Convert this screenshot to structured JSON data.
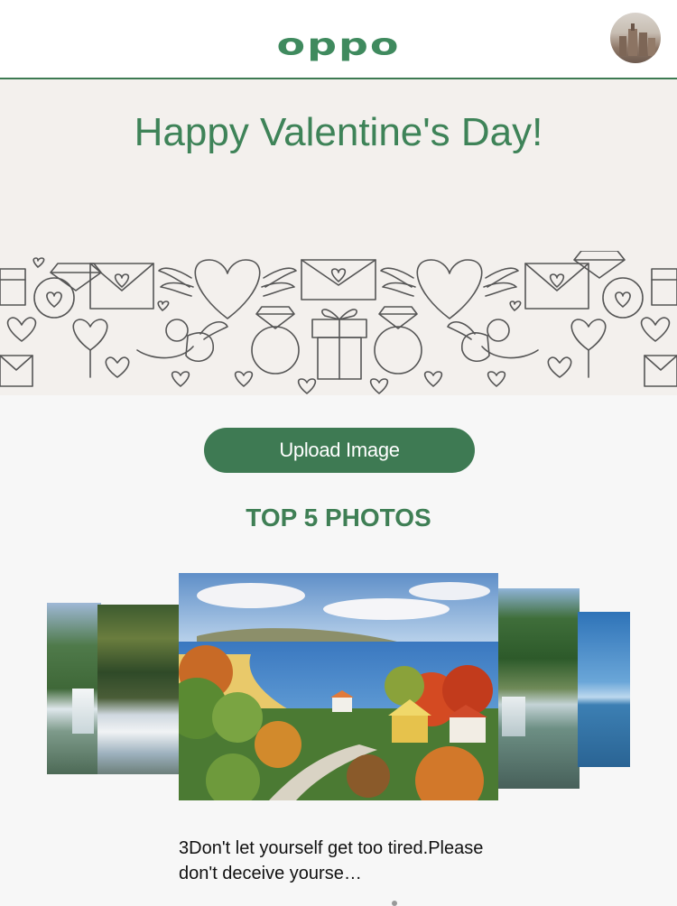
{
  "header": {
    "logo_text": "oppo",
    "brand_color": "#3f8a5e"
  },
  "banner": {
    "title": "Happy Valentine's Day!",
    "title_color": "#3e8358",
    "background": "#f3f0ed"
  },
  "actions": {
    "upload_label": "Upload Image",
    "upload_color": "#3e7a53"
  },
  "gallery": {
    "section_title": "TOP 5 PHOTOS",
    "photos": [
      {
        "subject": "waterfall"
      },
      {
        "subject": "river-rapids"
      },
      {
        "subject": "seaside-village-painting"
      },
      {
        "subject": "waterfall-cliff"
      },
      {
        "subject": "ocean"
      }
    ],
    "caption": "3Don't let yourself get too tired.Please don't deceive yourse…"
  }
}
